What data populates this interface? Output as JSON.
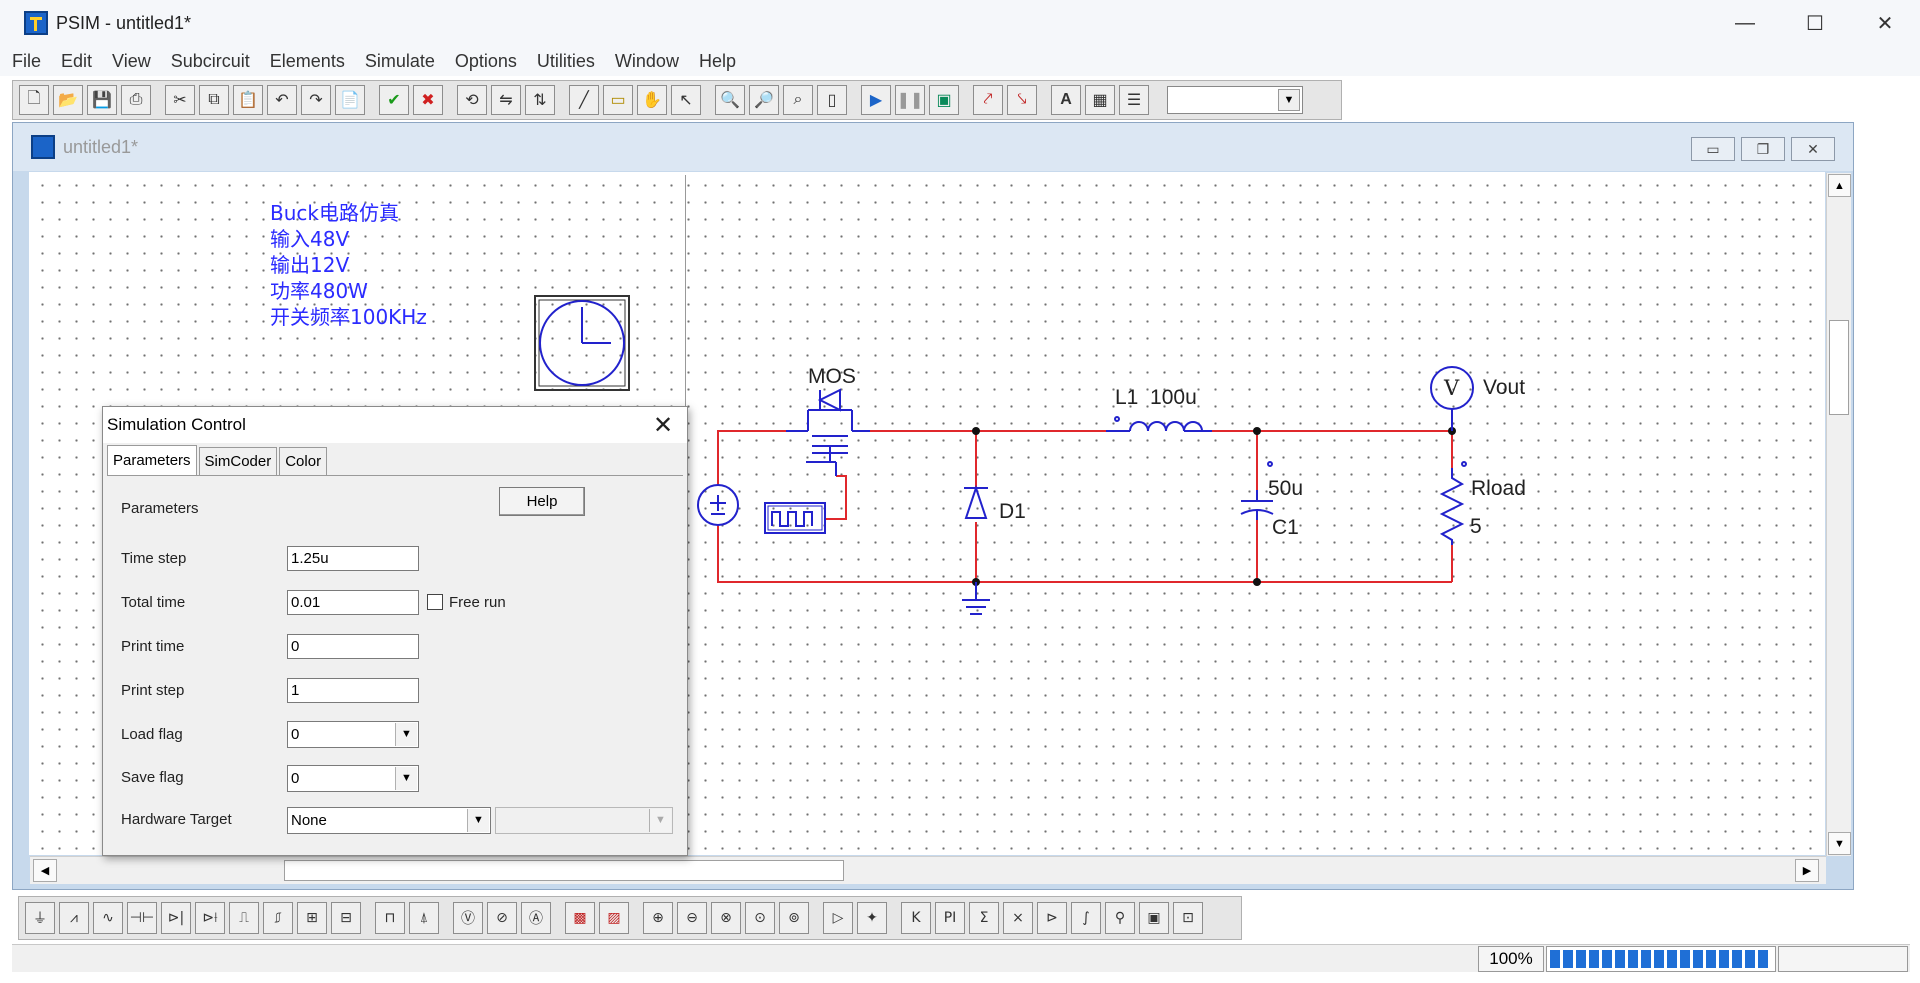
{
  "window": {
    "title": "PSIM - untitled1*",
    "controls": [
      "—",
      "☐",
      "✕"
    ]
  },
  "menu": [
    "File",
    "Edit",
    "View",
    "Subcircuit",
    "Elements",
    "Simulate",
    "Options",
    "Utilities",
    "Window",
    "Help"
  ],
  "document": {
    "title": "untitled1*",
    "controls": [
      "▭",
      "❐",
      "✕"
    ]
  },
  "note_lines": [
    "Buck电路仿真",
    "输入48V",
    "输出12V",
    "功率480W",
    "开关频率100KHz"
  ],
  "schematic": {
    "mos_label": "MOS",
    "diode_label": "D1",
    "inductor_label": "L1  100u",
    "cap_value": "50u",
    "cap_label": "C1",
    "load_label": "Rload",
    "load_value": "5",
    "probe_label": "Vout",
    "probe_symbol": "V",
    "wire_color": "#e0282c",
    "component_color": "#2222cc"
  },
  "dialog": {
    "title": "Simulation Control",
    "close": "✕",
    "tabs": [
      "Parameters",
      "SimCoder",
      "Color"
    ],
    "section_label": "Parameters",
    "help_button": "Help",
    "fields": {
      "time_step": {
        "label": "Time step",
        "value": "1.25u"
      },
      "total_time": {
        "label": "Total time",
        "value": "0.01"
      },
      "free_run": {
        "label": "Free run"
      },
      "print_time": {
        "label": "Print time",
        "value": "0"
      },
      "print_step": {
        "label": "Print step",
        "value": "1"
      },
      "load_flag": {
        "label": "Load flag",
        "value": "0"
      },
      "save_flag": {
        "label": "Save flag",
        "value": "0"
      },
      "hardware_target": {
        "label": "Hardware Target",
        "value": "None"
      }
    }
  },
  "status": {
    "zoom": "100%",
    "progress": 1.0
  },
  "colors": {
    "note_text": "#2b2bff",
    "wire": "#e0282c",
    "component": "#2222cc",
    "progress": "#1f6fd6"
  }
}
